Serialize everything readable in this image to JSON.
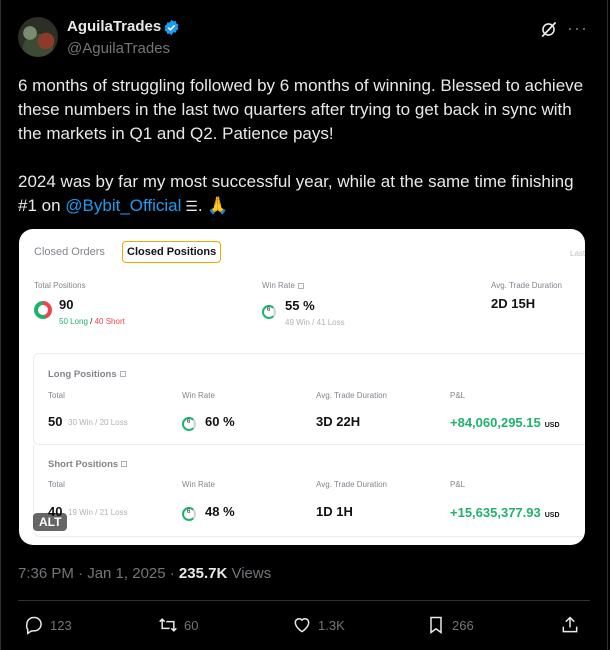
{
  "author": {
    "name": "AguilaTrades",
    "handle": "@AguilaTrades",
    "verified_color": "#1d9bf0"
  },
  "tweet": {
    "p1": "6 months of struggling followed by 6 months of winning. Blessed to achieve these numbers in the last two quarters after trying to get back in sync with the markets in Q1 and Q2. Patience pays!",
    "p2_before": "2024 was by far my most successful year, while at the same time finishing  #1 on ",
    "mention": "@Bybit_Official",
    "p2_after": ". 🙏"
  },
  "card": {
    "tabs": [
      "Closed Orders",
      "Closed Positions",
      "Last"
    ],
    "total_positions_label": "Total Positions",
    "total_positions": "90",
    "long_count": "50 Long",
    "separator": " / ",
    "short_count": "40 Short",
    "win_rate_label": "Win Rate",
    "win_rate": "55 %",
    "win_loss": "49 Win / 41 Loss",
    "avg_duration_label": "Avg. Trade Duration",
    "avg_duration": "2D 15H",
    "long": {
      "title": "Long Positions",
      "total_label": "Total",
      "total": "50",
      "total_sub": "30 Win / 20 Loss",
      "win_rate_label": "Win Rate",
      "win_rate": "60 %",
      "duration_label": "Avg. Trade Duration",
      "duration": "3D 22H",
      "pnl_label": "P&L",
      "pnl": "+84,060,295.15",
      "currency": "USD"
    },
    "short": {
      "title": "Short Positions",
      "total_label": "Total",
      "total": "40",
      "total_sub": "19 Win / 21 Loss",
      "win_rate_label": "Win Rate",
      "win_rate": "48 %",
      "duration_label": "Avg. Trade Duration",
      "duration": "1D 1H",
      "pnl_label": "P&L",
      "pnl": "+15,635,377.93",
      "currency": "USD"
    },
    "alt_badge": "ALT"
  },
  "meta": {
    "time": "7:36 PM · Jan 1, 2025 · ",
    "views_count": "235.7K",
    "views_label": " Views"
  },
  "actions": {
    "replies": "123",
    "reposts": "60",
    "likes": "1.3K",
    "bookmarks": "266"
  }
}
